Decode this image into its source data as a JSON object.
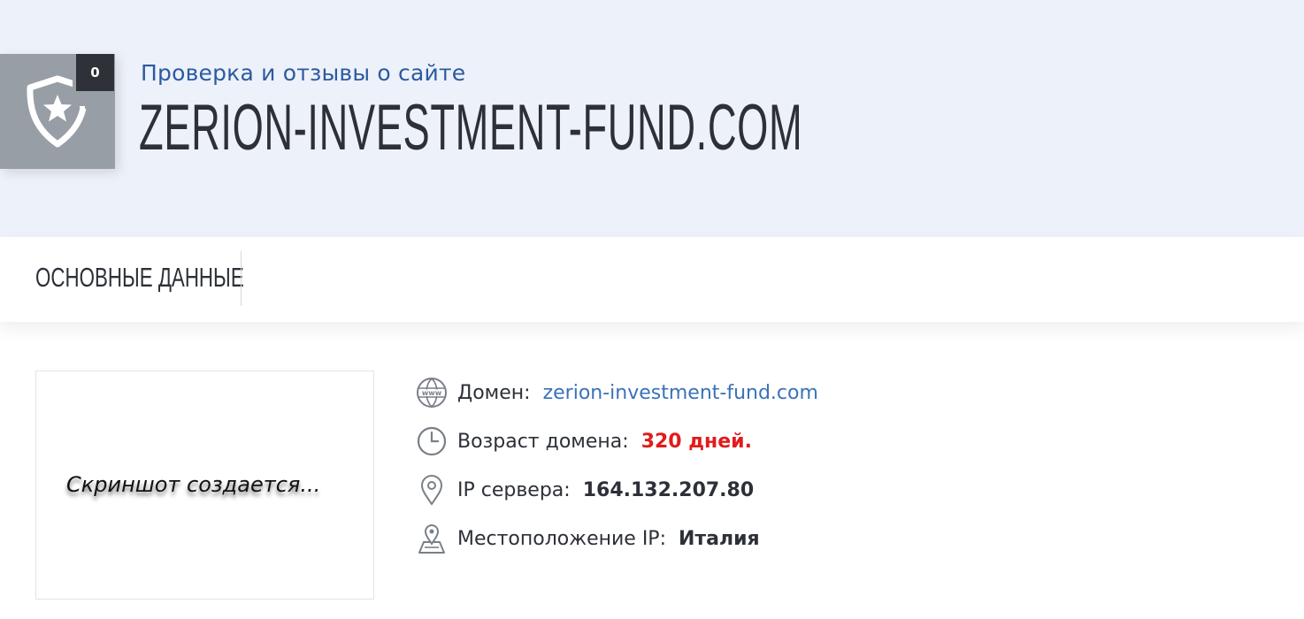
{
  "header": {
    "counter": "0",
    "subtitle": "Проверка и отзывы о сайте",
    "title": "ZERION-INVESTMENT-FUND.COM",
    "badge_icon": "shield-star-icon"
  },
  "tabs": [
    {
      "label": "ОСНОВНЫЕ ДАННЫЕ"
    }
  ],
  "screenshot": {
    "placeholder": "Скриншот создается..."
  },
  "info": {
    "domain": {
      "icon": "www-globe-icon",
      "label": "Домен:",
      "value": "zerion-investment-fund.com"
    },
    "age": {
      "icon": "clock-icon",
      "label": "Возраст домена:",
      "value": "320 дней."
    },
    "ip": {
      "icon": "location-pin-icon",
      "label": "IP сервера:",
      "value": "164.132.207.80"
    },
    "location": {
      "icon": "map-pin-icon",
      "label": "Местоположение IP:",
      "value": "Италия"
    }
  },
  "colors": {
    "hero_bg": "#edf1f9",
    "subtitle": "#2c5aa0",
    "link": "#3a72b8",
    "age_value": "#e11c1c",
    "badge_bg": "#989ea5",
    "counter_bg": "#2e3238"
  }
}
